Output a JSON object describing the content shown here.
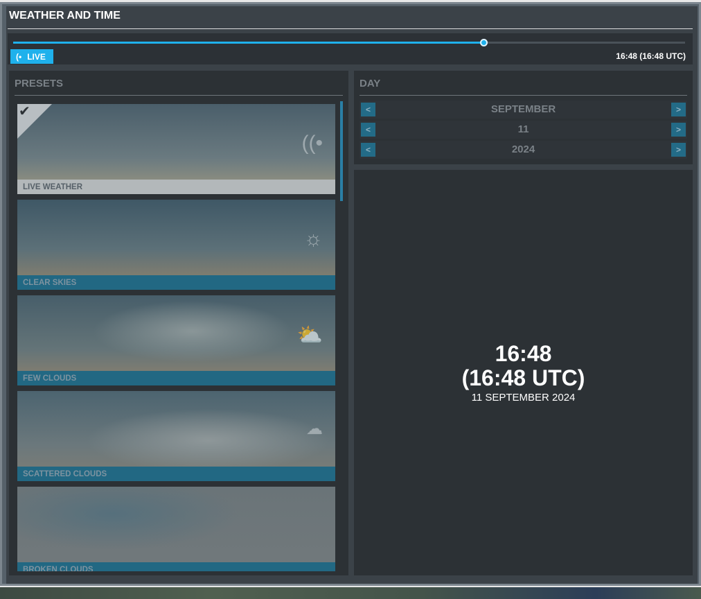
{
  "title": "WEATHER AND TIME",
  "slider": {
    "progress_percent": 70
  },
  "live_label": "LIVE",
  "time_display": "16:48 (16:48 UTC)",
  "presets": {
    "heading": "PRESETS",
    "items": [
      {
        "label": "LIVE WEATHER",
        "icon": "live-icon",
        "selected": true
      },
      {
        "label": "CLEAR SKIES",
        "icon": "sun-icon"
      },
      {
        "label": "FEW CLOUDS",
        "icon": "sun-cloud-icon"
      },
      {
        "label": "SCATTERED CLOUDS",
        "icon": "clouds-icon"
      },
      {
        "label": "BROKEN CLOUDS",
        "icon": ""
      }
    ]
  },
  "day": {
    "heading": "DAY",
    "month": "SEPTEMBER",
    "day": "11",
    "year": "2024",
    "prev": "<",
    "next": ">"
  },
  "clock": {
    "local": "16:48",
    "utc": "(16:48 UTC)",
    "date": "11 SEPTEMBER 2024"
  }
}
